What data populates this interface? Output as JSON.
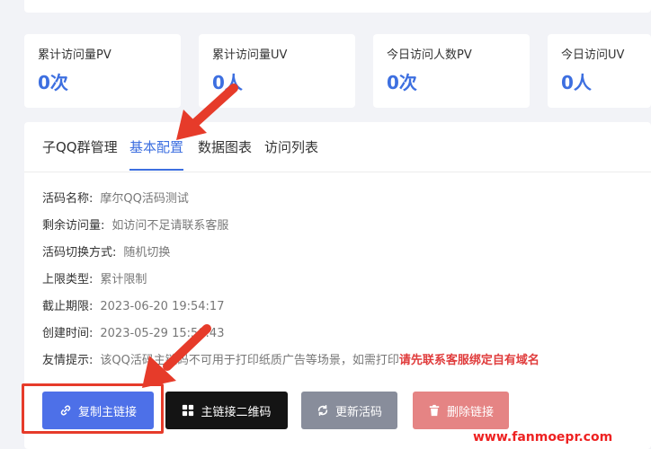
{
  "stats": [
    {
      "label": "累计访问量PV",
      "value": "0次"
    },
    {
      "label": "累计访问量UV",
      "value": "0人"
    },
    {
      "label": "今日访问人数PV",
      "value": "0次"
    },
    {
      "label": "今日访问UV",
      "value": "0人"
    }
  ],
  "tabs": [
    {
      "label": "子QQ群管理"
    },
    {
      "label": "基本配置",
      "active": true
    },
    {
      "label": "数据图表"
    },
    {
      "label": "访问列表"
    }
  ],
  "details": {
    "name_label": "活码名称:",
    "name_value": "摩尔QQ活码测试",
    "remaining_label": "剩余访问量:",
    "remaining_value": "如访问不足请联系客服",
    "switch_label": "活码切换方式:",
    "switch_value": "随机切换",
    "limit_label": "上限类型:",
    "limit_value": "累计限制",
    "deadline_label": "截止期限:",
    "deadline_value": "2023-06-20 19:54:17",
    "created_label": "创建时间:",
    "created_value": "2023-05-29 15:50:43",
    "tip_label": "友情提示:",
    "tip_value": "该QQ活码主链码不可用于打印纸质广告等场景，如需打印",
    "tip_highlight": "请先联系客服绑定自有域名"
  },
  "buttons": {
    "copy": "复制主链接",
    "qr": "主链接二维码",
    "refresh": "更新活码",
    "delete": "删除链接"
  },
  "icons": {
    "copy": "link-icon",
    "qr": "qrcode-icon",
    "refresh": "refresh-icon",
    "delete": "trash-icon"
  },
  "colors": {
    "accent": "#3d6fe0",
    "annotation": "#e63b2a",
    "highlight_text": "#e03c3c"
  },
  "watermark": "www.fanmoepr.com"
}
